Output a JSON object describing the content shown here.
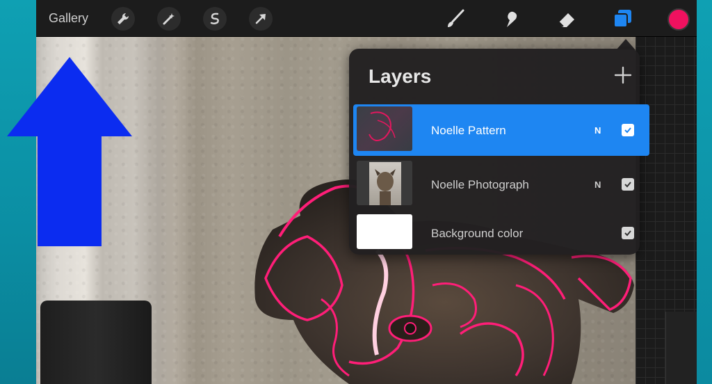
{
  "toolbar": {
    "gallery_label": "Gallery",
    "left_tools": [
      "wrench-icon",
      "magic-wand-icon",
      "selection-icon",
      "transform-arrow-icon"
    ],
    "right_tools": [
      "brush-icon",
      "smudge-icon",
      "eraser-icon",
      "layers-icon"
    ],
    "active_color": "#f0115f",
    "accent": "#1e86f2"
  },
  "layers": {
    "title": "Layers",
    "items": [
      {
        "name": "Noelle Pattern",
        "blend": "N",
        "visible": true,
        "active": true
      },
      {
        "name": "Noelle Photograph",
        "blend": "N",
        "visible": true,
        "active": false
      },
      {
        "name": "Background color",
        "blend": "",
        "visible": true,
        "active": false
      }
    ]
  }
}
